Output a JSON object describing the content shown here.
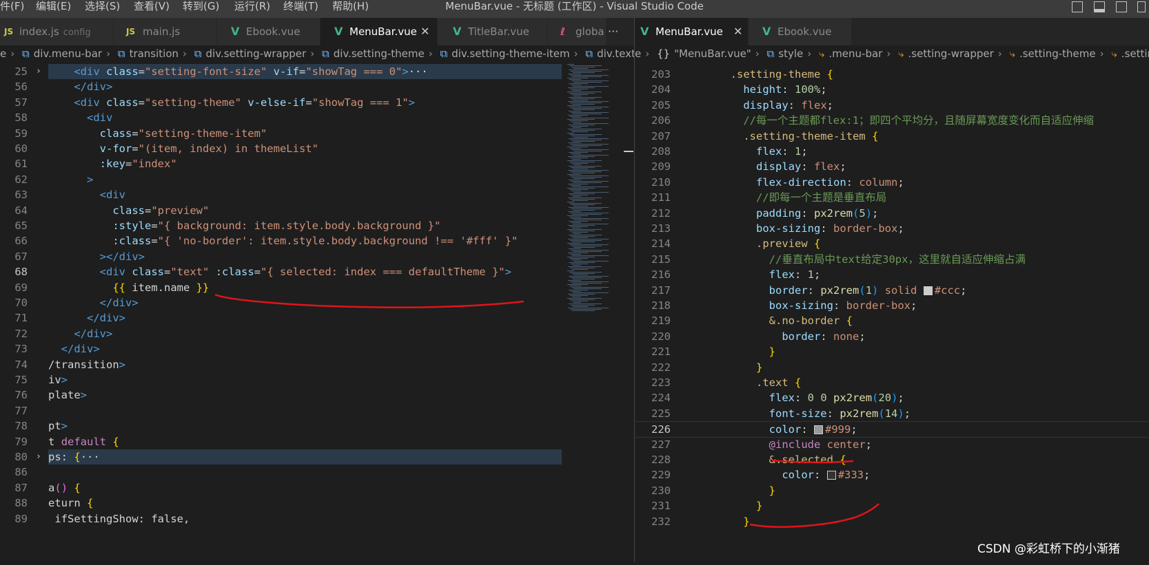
{
  "menu": [
    "件(F)",
    "编辑(E)",
    "选择(S)",
    "查看(V)",
    "转到(G)",
    "运行(R)",
    "终端(T)",
    "帮助(H)"
  ],
  "window_title": "MenuBar.vue - 无标题 (工作区) - Visual Studio Code",
  "left_tabs": [
    {
      "icon": "JS",
      "label": "index.js",
      "desc": "config",
      "active": false
    },
    {
      "icon": "JS",
      "label": "main.js",
      "desc": "",
      "active": false
    },
    {
      "icon": "V",
      "label": "Ebook.vue",
      "desc": "",
      "active": false
    },
    {
      "icon": "V",
      "label": "MenuBar.vue",
      "desc": "",
      "active": true,
      "close": "✕"
    },
    {
      "icon": "V",
      "label": "TitleBar.vue",
      "desc": "",
      "active": false
    },
    {
      "icon": "ℓ",
      "label": "globa",
      "desc": "",
      "active": false
    }
  ],
  "left_tabs_more": "···",
  "right_tabs": [
    {
      "icon": "V",
      "label": "MenuBar.vue",
      "active": true,
      "close": "✕"
    },
    {
      "icon": "V",
      "label": "Ebook.vue",
      "active": false
    }
  ],
  "left_breadcrumb": [
    "e",
    "div.menu-bar",
    "transition",
    "div.setting-wrapper",
    "div.setting-theme",
    "div.setting-theme-item",
    "div.text"
  ],
  "right_breadcrumb": [
    "e",
    "\"MenuBar.vue\"",
    "style",
    ".menu-bar",
    ".setting-wrapper",
    ".setting-theme",
    ".settin"
  ],
  "left_line_numbers": [
    "25",
    "56",
    "57",
    "58",
    "59",
    "60",
    "61",
    "62",
    "63",
    "64",
    "65",
    "66",
    "67",
    "68",
    "69",
    "70",
    "71",
    "72",
    "73",
    "74",
    "75",
    "76",
    "77",
    "78",
    "79",
    "80",
    "86",
    "87",
    "88",
    "89",
    ""
  ],
  "left_code": [
    "    <div class=\"setting-font-size\" v-if=\"showTag === 0\">···",
    "    </div>",
    "    <div class=\"setting-theme\" v-else-if=\"showTag === 1\">",
    "      <div",
    "        class=\"setting-theme-item\"",
    "        v-for=\"(item, index) in themeList\"",
    "        :key=\"index\"",
    "      >",
    "        <div",
    "          class=\"preview\"",
    "          :style=\"{ background: item.style.body.background }\"",
    "          :class=\"{ 'no-border': item.style.body.background !== '#fff' }\"",
    "        ></div>",
    "        <div class=\"text\" :class=\"{ selected: index === defaultTheme }\">",
    "          {{ item.name }}",
    "        </div>",
    "      </div>",
    "    </div>",
    "  </div>",
    "/transition>",
    "iv>",
    "plate>",
    "",
    "pt>",
    "t default {",
    "ps: {···",
    "",
    "a() {",
    "eturn {",
    " ifSettingShow: false,",
    ""
  ],
  "right_line_numbers": [
    "203",
    "204",
    "205",
    "206",
    "207",
    "208",
    "209",
    "210",
    "211",
    "212",
    "213",
    "214",
    "215",
    "216",
    "217",
    "218",
    "219",
    "220",
    "221",
    "222",
    "223",
    "224",
    "225",
    "226",
    "227",
    "228",
    "229",
    "230",
    "231",
    "232"
  ],
  "right_code": [
    "  .setting-theme {",
    "    height: 100%;",
    "    display: flex;",
    "    //每一个主题都flex:1；即四个平均分，且随屏幕宽度变化而自适应伸缩",
    "    .setting-theme-item {",
    "      flex: 1;",
    "      display: flex;",
    "      flex-direction: column;",
    "      //即每一个主题是垂直布局",
    "      padding: px2rem(5);",
    "      box-sizing: border-box;",
    "      .preview {",
    "        //垂直布局中text给定30px，这里就自适应伸缩占满",
    "        flex: 1;",
    "        border: px2rem(1) solid #ccc;",
    "        box-sizing: border-box;",
    "        &.no-border {",
    "          border: none;",
    "        }",
    "      }",
    "      .text {",
    "        flex: 0 0 px2rem(20);",
    "        font-size: px2rem(14);",
    "        color: #999;",
    "        @include center;",
    "        &.selected {",
    "          color: #333;",
    "        }",
    "      }",
    "    }"
  ],
  "colors": {
    "swatch_ccc": "#cccccc",
    "swatch_999": "#999999",
    "swatch_333": "#333333",
    "annotation": "#e0151b"
  },
  "watermark": "CSDN @彩虹桥下的小渐猪"
}
